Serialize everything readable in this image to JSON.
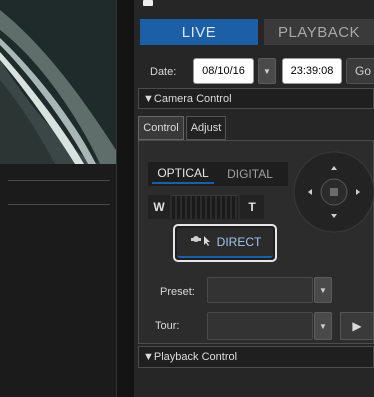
{
  "header": {
    "live_label": "LIVE",
    "playback_label": "PLAYBACK"
  },
  "date_row": {
    "label": "Date:",
    "date_value": "08/10/16",
    "time_value": "23:39:08",
    "go_label": "Go"
  },
  "camera_control": {
    "title": "▼Camera Control",
    "tabs": [
      {
        "label": "Control"
      },
      {
        "label": "Adjust"
      }
    ],
    "zoom_mode": {
      "optical_label": "OPTICAL",
      "digital_label": "DIGITAL"
    },
    "zoom": {
      "wide_label": "W",
      "tele_label": "T"
    },
    "direct_label": "DIRECT",
    "preset": {
      "label": "Preset:",
      "value": ""
    },
    "tour": {
      "label": "Tour:",
      "value": ""
    }
  },
  "playback_control": {
    "title": "▼Playback Control"
  },
  "icons": {
    "dropdown": "chevron-down-icon",
    "ptz": "dpad-icon",
    "direct": "camera-pointer-icon",
    "play": "play-icon"
  },
  "colors": {
    "accent": "#1d5fa7",
    "panel": "#262626"
  }
}
